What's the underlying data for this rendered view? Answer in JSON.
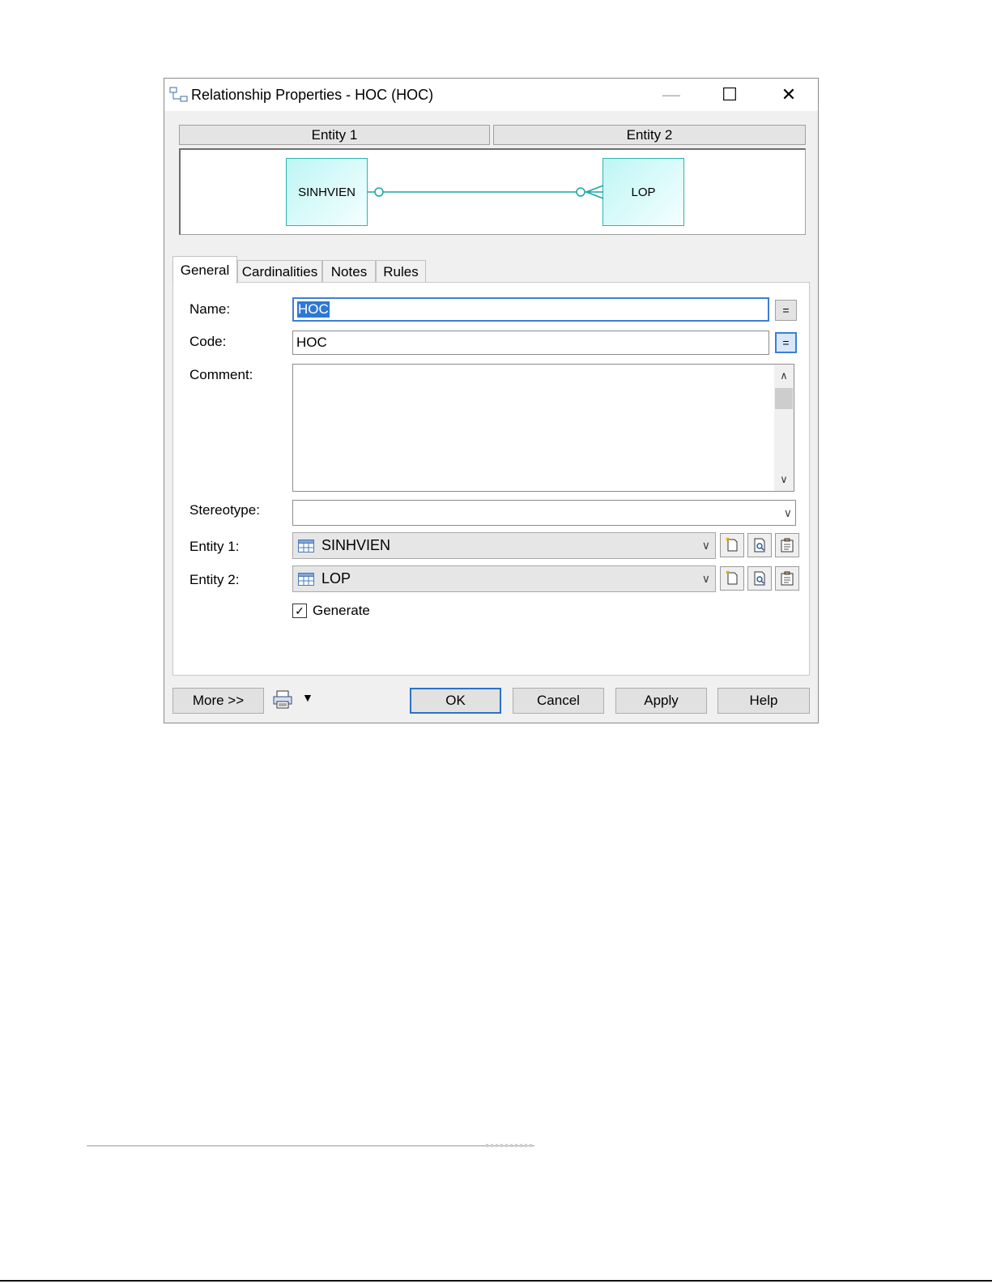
{
  "window": {
    "title": "Relationship Properties - HOC (HOC)",
    "controls": {
      "minimize": "—",
      "maximize": "☐",
      "close": "✕"
    }
  },
  "diagram": {
    "col1": "Entity 1",
    "col2": "Entity 2",
    "entity1": "SINHVIEN",
    "entity2": "LOP",
    "line_color": "#1aa6a6"
  },
  "tabs": [
    "General",
    "Cardinalities",
    "Notes",
    "Rules"
  ],
  "form": {
    "name_label": "Name:",
    "name_value": "HOC",
    "code_label": "Code:",
    "code_value": "HOC",
    "comment_label": "Comment:",
    "comment_value": "",
    "stereotype_label": "Stereotype:",
    "stereotype_value": "",
    "entity1_label": "Entity 1:",
    "entity1_value": "SINHVIEN",
    "entity2_label": "Entity 2:",
    "entity2_value": "LOP",
    "generate_label": "Generate",
    "generate_checked": true,
    "eq_button": "="
  },
  "buttons": {
    "more": "More >>",
    "ok": "OK",
    "cancel": "Cancel",
    "apply": "Apply",
    "help": "Help"
  },
  "icons": [
    "relationship-icon",
    "table-icon",
    "new-icon",
    "browse-icon",
    "properties-icon",
    "printer-icon"
  ],
  "colors": {
    "accent": "#2e78d4",
    "entity_border": "#2fb2b2"
  }
}
